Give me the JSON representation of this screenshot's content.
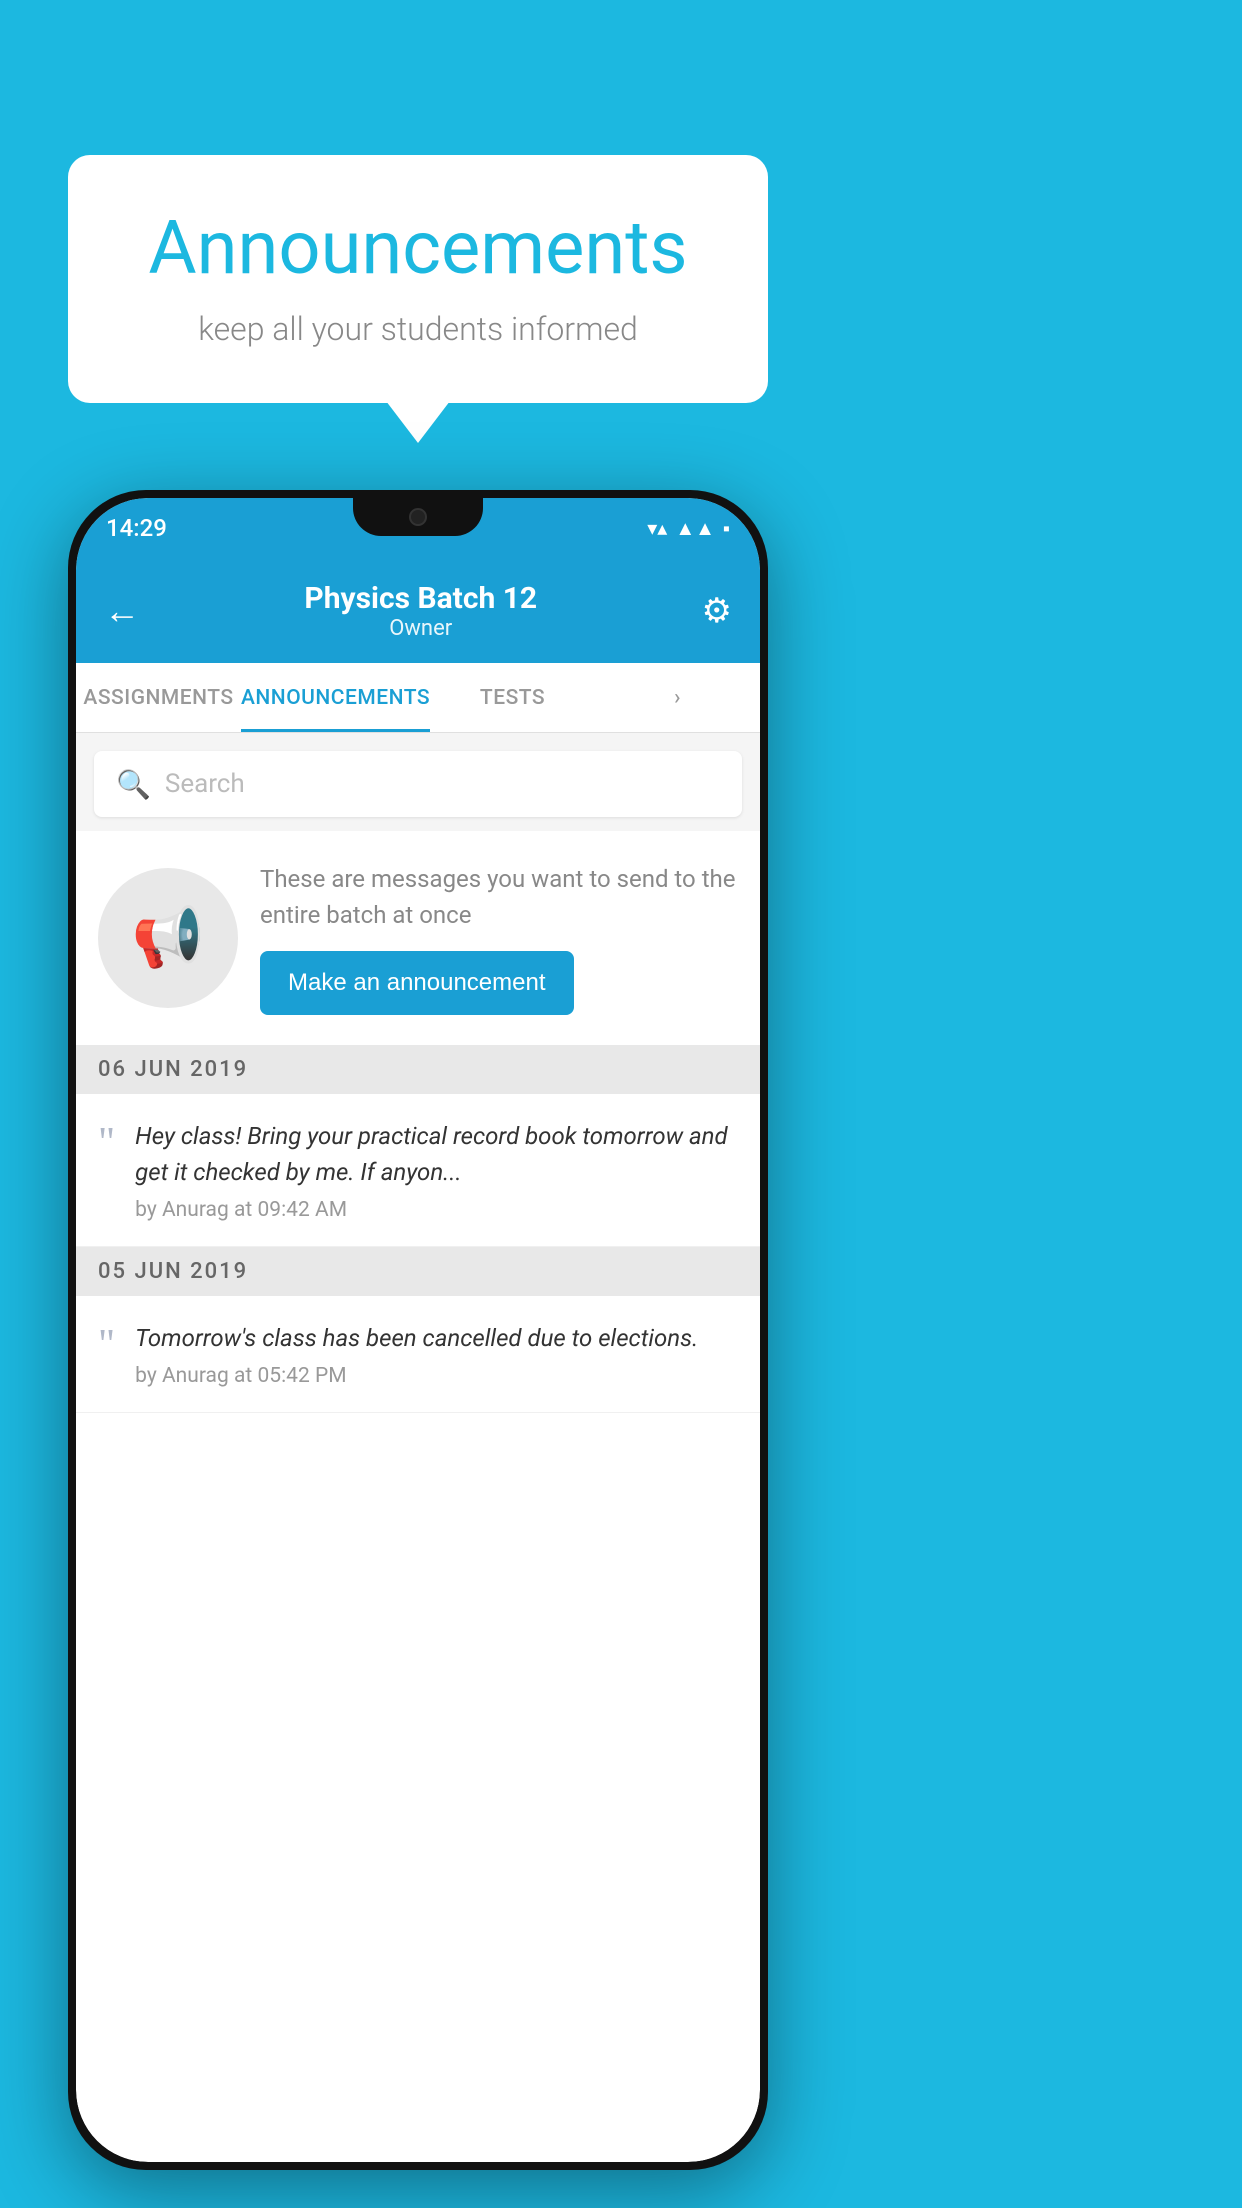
{
  "background_color": "#1cb8e0",
  "speech_bubble": {
    "title": "Announcements",
    "subtitle": "keep all your students informed"
  },
  "phone": {
    "status_bar": {
      "time": "14:29",
      "wifi": "▼",
      "signal": "▲",
      "battery": "▪"
    },
    "header": {
      "back_label": "←",
      "title": "Physics Batch 12",
      "subtitle": "Owner",
      "gear_label": "⚙"
    },
    "tabs": [
      {
        "label": "ASSIGNMENTS",
        "active": false
      },
      {
        "label": "ANNOUNCEMENTS",
        "active": true
      },
      {
        "label": "TESTS",
        "active": false
      },
      {
        "label": "›",
        "active": false
      }
    ],
    "search": {
      "placeholder": "Search"
    },
    "promo": {
      "description": "These are messages you want to send to the entire batch at once",
      "button_label": "Make an announcement"
    },
    "announcements": [
      {
        "date": "06  JUN  2019",
        "message": "Hey class! Bring your practical record book tomorrow and get it checked by me. If anyon...",
        "meta": "by Anurag at 09:42 AM"
      },
      {
        "date": "05  JUN  2019",
        "message": "Tomorrow's class has been cancelled due to elections.",
        "meta": "by Anurag at 05:42 PM"
      }
    ]
  }
}
